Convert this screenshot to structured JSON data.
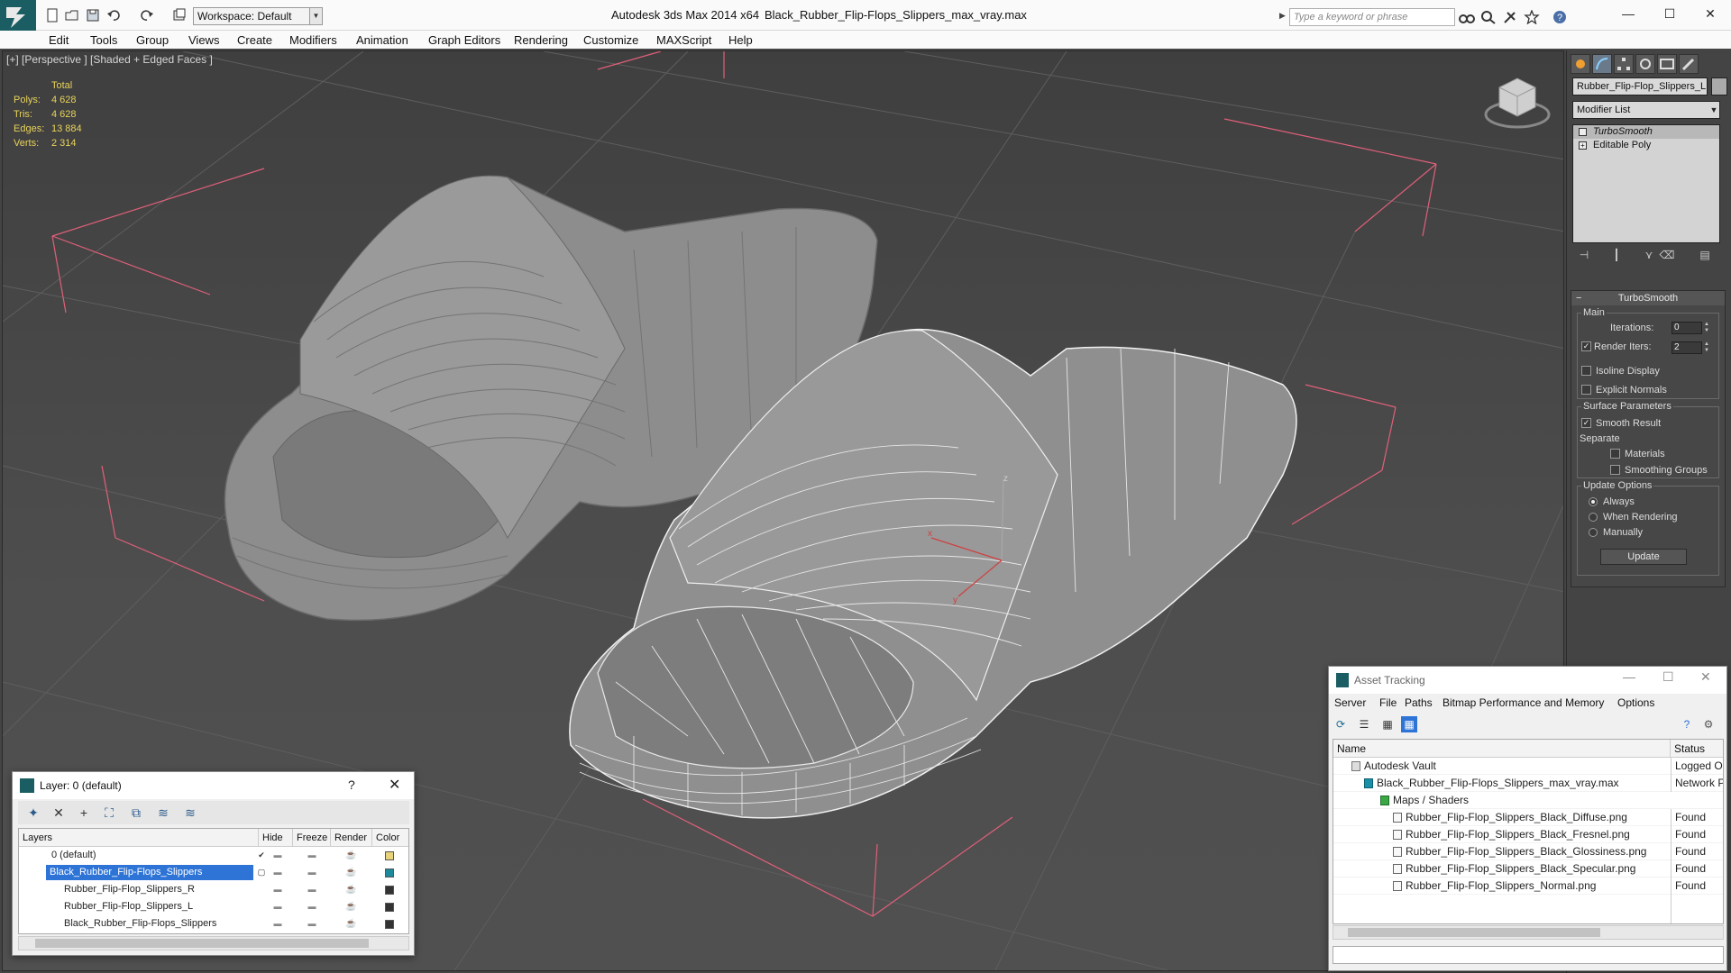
{
  "titlebar": {
    "workspace": "Workspace: Default",
    "app_title": "Autodesk 3ds Max  2014 x64",
    "file_title": "Black_Rubber_Flip-Flops_Slippers_max_vray.max",
    "search_placeholder": "Type a keyword or phrase"
  },
  "menu": [
    "Edit",
    "Tools",
    "Group",
    "Views",
    "Create",
    "Modifiers",
    "Animation",
    "Graph Editors",
    "Rendering",
    "Customize",
    "MAXScript",
    "Help"
  ],
  "viewport": {
    "label": "[+] [Perspective ] [Shaded + Edged Faces ]",
    "stats": {
      "header": "Total",
      "rows": [
        {
          "k": "Polys:",
          "v": "4 628"
        },
        {
          "k": "Tris:",
          "v": "4 628"
        },
        {
          "k": "Edges:",
          "v": "13 884"
        },
        {
          "k": "Verts:",
          "v": "2 314"
        }
      ]
    },
    "axis": {
      "x": "x",
      "y": "y",
      "z": "z"
    }
  },
  "command_panel": {
    "object_name": "Rubber_Flip-Flop_Slippers_L",
    "modifier_list": "Modifier List",
    "stack": [
      "TurboSmooth",
      "Editable Poly"
    ],
    "rollout_title": "TurboSmooth",
    "main_group": "Main",
    "iterations_label": "Iterations:",
    "iterations_value": "0",
    "render_iters_label": "Render Iters:",
    "render_iters_value": "2",
    "isoline_label": "Isoline Display",
    "explicit_normals_label": "Explicit Normals",
    "surface_group": "Surface Parameters",
    "smooth_result_label": "Smooth Result",
    "separate_label": "Separate",
    "materials_label": "Materials",
    "smoothing_groups_label": "Smoothing Groups",
    "update_group": "Update Options",
    "always_label": "Always",
    "when_rendering_label": "When Rendering",
    "manually_label": "Manually",
    "update_button": "Update"
  },
  "layer_dialog": {
    "title": "Layer: 0 (default)",
    "help": "?",
    "columns": [
      "Layers",
      "Hide",
      "Freeze",
      "Render",
      "Color"
    ],
    "rows": [
      {
        "name": "0 (default)",
        "color": "#e8d27a"
      },
      {
        "name": "Black_Rubber_Flip-Flops_Slippers",
        "color": "#1c8a9a"
      },
      {
        "name": "Rubber_Flip-Flop_Slippers_R",
        "color": "#333333"
      },
      {
        "name": "Rubber_Flip-Flop_Slippers_L",
        "color": "#333333"
      },
      {
        "name": "Black_Rubber_Flip-Flops_Slippers",
        "color": "#333333"
      }
    ]
  },
  "asset_dialog": {
    "title": "Asset Tracking",
    "menu": [
      "Server",
      "File",
      "Paths",
      "Bitmap Performance and Memory",
      "Options"
    ],
    "columns": [
      "Name",
      "Status"
    ],
    "rows": [
      {
        "name": "Autodesk Vault",
        "status": "Logged Ou"
      },
      {
        "name": "Black_Rubber_Flip-Flops_Slippers_max_vray.max",
        "status": "Network P"
      },
      {
        "name": "Maps / Shaders",
        "status": ""
      },
      {
        "name": "Rubber_Flip-Flop_Slippers_Black_Diffuse.png",
        "status": "Found"
      },
      {
        "name": "Rubber_Flip-Flop_Slippers_Black_Fresnel.png",
        "status": "Found"
      },
      {
        "name": "Rubber_Flip-Flop_Slippers_Black_Glossiness.png",
        "status": "Found"
      },
      {
        "name": "Rubber_Flip-Flop_Slippers_Black_Specular.png",
        "status": "Found"
      },
      {
        "name": "Rubber_Flip-Flop_Slippers_Normal.png",
        "status": "Found"
      }
    ]
  },
  "colors": {
    "accent": "#1a5e63",
    "selection": "#2e74d6",
    "stats_text": "#e8d35a",
    "bbox": "#e0607a"
  }
}
